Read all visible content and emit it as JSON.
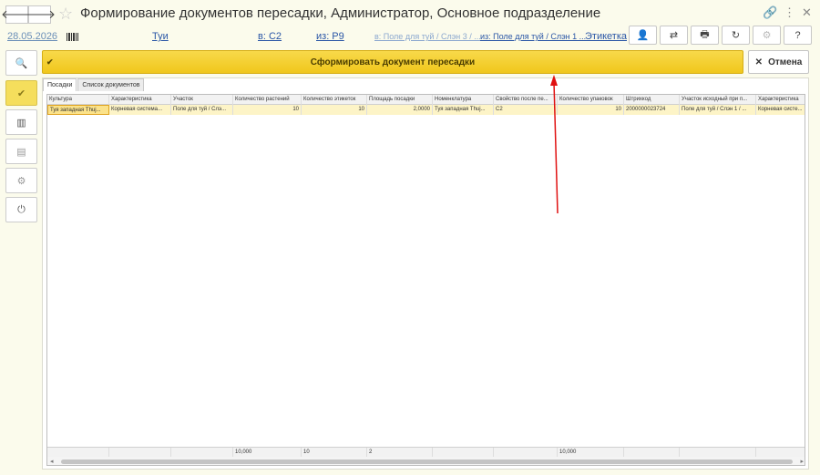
{
  "window": {
    "title": "Формирование документов пересадки, Администратор, Основное подразделение",
    "back_glyph": "🡐",
    "forward_glyph": "🡒",
    "star_glyph": "☆",
    "link_glyph": "🔗",
    "menu_glyph": "⋮",
    "close_glyph": "✕"
  },
  "info": {
    "date": "28.05.2026",
    "culture": "Туи",
    "to_property": "в: С2",
    "from_property": "из: Р9",
    "to_place": "в: Поле для туй / Слэн 3 / ...",
    "from_place": "из: Поле для туй / Слэн 1 ...",
    "label_link": "Этикетка"
  },
  "toolbar": {
    "icons": [
      "user-icon",
      "transfer-icon",
      "print-icon",
      "refresh-icon",
      "settings-icon",
      "help-icon"
    ],
    "glyphs": [
      "👤",
      "⇄",
      "🖶",
      "↻",
      "⚙",
      "?"
    ]
  },
  "left_buttons": [
    {
      "icon": "search-icon",
      "glyph": "🔍"
    },
    {
      "icon": "checkmark-icon",
      "glyph": "✔"
    },
    {
      "icon": "barcode-icon",
      "glyph": "▥"
    },
    {
      "icon": "document-icon",
      "glyph": "▤"
    },
    {
      "icon": "settings-icon",
      "glyph": "⚙"
    },
    {
      "icon": "power-icon",
      "glyph": "⏻"
    }
  ],
  "actions": {
    "create": "Сформировать документ  пересадки",
    "create_icon": "✔",
    "cancel": "Отмена",
    "cancel_icon": "✕"
  },
  "tabs": [
    {
      "label": "Посадки",
      "active": true
    },
    {
      "label": "Список документов",
      "active": false
    }
  ],
  "table": {
    "columns": [
      "Культура",
      "Характеристика",
      "Участок",
      "Количество растений",
      "Количество этикеток",
      "Площадь посадки",
      "Номенклатура",
      "Свойство после пе...",
      "Количество упаковок",
      "Штрихкод",
      "Участок исходный при п...",
      "Характеристика"
    ],
    "rows": [
      [
        "Туя западная Thuj...",
        "Корневая система...",
        "Поле для туй / Слэ...",
        "10",
        "10",
        "2,0000",
        "Туя западная Thuj...",
        "С2",
        "10",
        "2000000023724",
        "Поле для туй / Слэн 1 / ...",
        "Корневая систе..."
      ]
    ],
    "totals": [
      "",
      "",
      "",
      "10,000",
      "10",
      "2",
      "",
      "",
      "10,000",
      "",
      "",
      ""
    ],
    "scroll_left_glyph": "◂",
    "scroll_right_glyph": "▸"
  }
}
